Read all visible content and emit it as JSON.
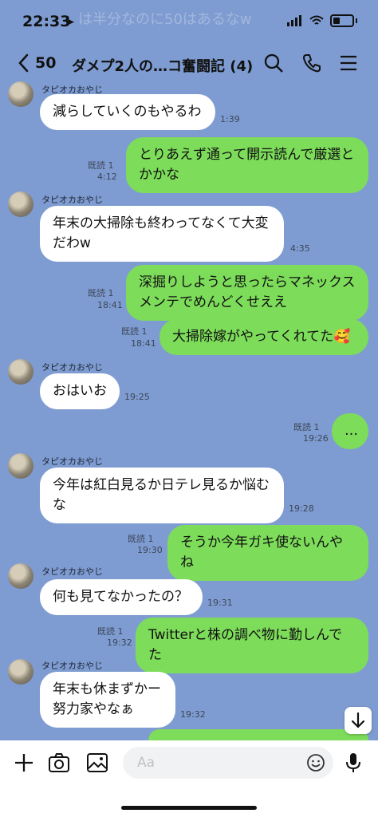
{
  "status": {
    "time": "22:33",
    "ghost_notification": "は半分なのに50はあるなw"
  },
  "header": {
    "back_count": "50",
    "title": "ダメプ2人の…コ奮闘記 (4)"
  },
  "sender_name": "タピオカおやじ",
  "read_label": "既読 1",
  "messages": [
    {
      "side": "left",
      "text": "減らしていくのもやるわ",
      "time": "1:39"
    },
    {
      "side": "right",
      "text": "とりあえず通って開示読んで厳選と\nかかな",
      "time": "4:12"
    },
    {
      "side": "left",
      "text": "年末の大掃除も終わってなくて大変\nだわw",
      "time": "4:35"
    },
    {
      "side": "right",
      "text": "深掘りしようと思ったらマネックス\nメンテでめんどくせええ",
      "time": "18:41"
    },
    {
      "side": "right",
      "text": "大掃除嫁がやってくれてた🥰",
      "time": "18:41"
    },
    {
      "side": "left",
      "text": "おはいお",
      "time": "19:25"
    },
    {
      "side": "right",
      "text": "…",
      "time": "19:26"
    },
    {
      "side": "left",
      "text": "今年は紅白見るか日テレ見るか悩む\nな",
      "time": "19:28"
    },
    {
      "side": "right",
      "text": "そうか今年ガキ使ないんやね",
      "time": "19:30"
    },
    {
      "side": "left",
      "text": "何も見てなかったの？",
      "time": "19:31"
    },
    {
      "side": "right",
      "text": "Twitterと株の調べ物に勤しんでた",
      "time": "19:32"
    },
    {
      "side": "left",
      "text": "年末も休まずかー\n努力家やなぁ",
      "time": "19:32"
    }
  ],
  "input": {
    "placeholder": "Aa"
  },
  "icons": {
    "scroll": "scroll-down-arrow-icon",
    "plus": "plus-icon",
    "camera": "camera-icon",
    "image": "image-icon",
    "emoji": "emoji-icon",
    "mic": "microphone-icon"
  }
}
